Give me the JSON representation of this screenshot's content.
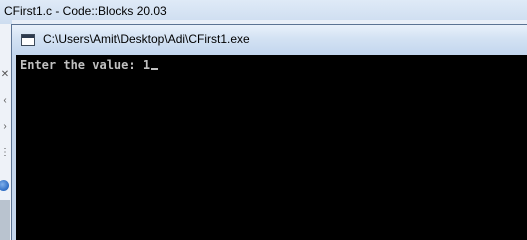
{
  "background_window": {
    "title": "CFirst1.c - Code::Blocks 20.03"
  },
  "console_window": {
    "title": "C:\\Users\\Amit\\Desktop\\Adi\\CFirst1.exe",
    "icon": "console-app-icon",
    "output": {
      "prompt": "Enter the value: ",
      "input_value": "1"
    },
    "colors": {
      "background": "#000000",
      "text": "#c0c0c0"
    }
  }
}
